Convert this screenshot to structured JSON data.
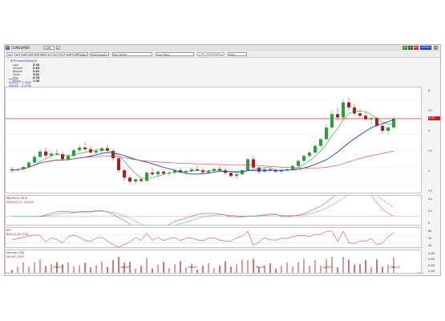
{
  "window": {
    "title": "CONSUMER",
    "symbol": "GSR",
    "footer_left": "1.4",
    "footer_right": "1:0:0"
  },
  "toolbar": {
    "interval": "1D",
    "range_buttons": [
      "1D",
      "1W",
      "1M",
      "3M",
      "6M",
      "1Y",
      "2Y",
      "5Y",
      "10Y",
      "YTD"
    ],
    "period_select": "Date",
    "chart_select": "Trend Supply",
    "study_select": "Bar (Short)",
    "tools_select": "Line (Tool)",
    "right_buttons": [
      "BT",
      "AL",
      "GET",
      "MATRIX"
    ],
    "theme_select": "Dark"
  },
  "quote": {
    "title": "IETFmarketData(D)",
    "rows": [
      {
        "label": "Last",
        "value": "5.40"
      },
      {
        "label": "Volume",
        "value": "5.65"
      },
      {
        "label": "Bid/Ask",
        "value": "5.61"
      },
      {
        "label": "Open",
        "value": "5.61"
      },
      {
        "label": "Chg",
        "value": "0.26"
      },
      {
        "label": "%Chg",
        "value": "1.08"
      }
    ]
  },
  "legend": [
    {
      "name": "MA(5)",
      "value": "",
      "color": "#2e9d3a"
    },
    {
      "name": "MA(20)",
      "value": "5.7406",
      "color": "#1f3fb8"
    },
    {
      "name": "MA(50)",
      "value": "5.3756",
      "color": "#1f3fb8"
    },
    {
      "name": "MA(200)",
      "value": "5.6451",
      "color": "#d04040"
    },
    {
      "name": "5.6.27",
      "value": "",
      "color": "#d04040"
    }
  ],
  "price_tags": [
    {
      "value": "5.44",
      "color": "#555555"
    },
    {
      "value": "5.47",
      "color": "#c62020"
    }
  ],
  "y_axis": [
    "6",
    "5.5",
    "5",
    "4.5",
    "4",
    "3.5"
  ],
  "macd": {
    "title": "MACD(12,26,9)",
    "legend": "MACD(9,12)    -0.0228",
    "y_axis": [
      "0.4",
      "0.2",
      "0"
    ]
  },
  "rsi": {
    "title": "RSI",
    "legend": "RSI(14)    56.1736",
    "y_axis": [
      "60",
      "50",
      "40"
    ]
  },
  "volume": {
    "title": "Volume (1M)",
    "legend": "Vol    847.1240",
    "y_axis": [
      "0.4M",
      "0.3M",
      "0.2M",
      "0.1M"
    ]
  },
  "x_axis": [
    "Dec21",
    "Jan22",
    "Feb22",
    "Mar22",
    "Apr22",
    "May22"
  ],
  "chart_data": {
    "type": "candlestick",
    "x": [
      "Dec21",
      "Jan22",
      "Feb22",
      "Mar22",
      "Apr22",
      "May22"
    ],
    "ohlc": [
      [
        3.95,
        4.02,
        3.85,
        3.92
      ],
      [
        3.92,
        3.98,
        3.88,
        3.95
      ],
      [
        3.95,
        4.05,
        3.9,
        4.02
      ],
      [
        4.02,
        4.2,
        4.0,
        4.15
      ],
      [
        4.15,
        4.38,
        4.1,
        4.32
      ],
      [
        4.32,
        4.55,
        4.28,
        4.48
      ],
      [
        4.48,
        4.6,
        4.3,
        4.36
      ],
      [
        4.36,
        4.5,
        4.25,
        4.42
      ],
      [
        4.42,
        4.55,
        4.35,
        4.4
      ],
      [
        4.4,
        4.48,
        4.2,
        4.25
      ],
      [
        4.25,
        4.4,
        4.18,
        4.35
      ],
      [
        4.35,
        4.58,
        4.3,
        4.52
      ],
      [
        4.52,
        4.7,
        4.45,
        4.6
      ],
      [
        4.6,
        4.75,
        4.5,
        4.55
      ],
      [
        4.55,
        4.65,
        4.4,
        4.45
      ],
      [
        4.45,
        4.58,
        4.38,
        4.5
      ],
      [
        4.5,
        4.62,
        4.42,
        4.58
      ],
      [
        4.58,
        4.68,
        4.45,
        4.5
      ],
      [
        4.5,
        4.55,
        4.2,
        4.28
      ],
      [
        4.28,
        4.3,
        3.85,
        3.92
      ],
      [
        3.92,
        3.98,
        3.6,
        3.7
      ],
      [
        3.7,
        3.78,
        3.52,
        3.58
      ],
      [
        3.58,
        3.7,
        3.5,
        3.65
      ],
      [
        3.65,
        3.72,
        3.55,
        3.6
      ],
      [
        3.6,
        3.9,
        3.58,
        3.85
      ],
      [
        3.85,
        4.0,
        3.75,
        3.8
      ],
      [
        3.8,
        3.92,
        3.7,
        3.88
      ],
      [
        3.88,
        3.95,
        3.78,
        3.82
      ],
      [
        3.82,
        3.9,
        3.75,
        3.85
      ],
      [
        3.85,
        3.95,
        3.8,
        3.92
      ],
      [
        3.92,
        4.0,
        3.82,
        3.86
      ],
      [
        3.86,
        3.94,
        3.78,
        3.9
      ],
      [
        3.9,
        4.0,
        3.85,
        3.95
      ],
      [
        3.95,
        4.05,
        3.88,
        3.92
      ],
      [
        3.92,
        3.98,
        3.82,
        3.86
      ],
      [
        3.86,
        3.95,
        3.8,
        3.9
      ],
      [
        3.9,
        4.0,
        3.85,
        3.96
      ],
      [
        3.96,
        4.05,
        3.9,
        3.92
      ],
      [
        3.92,
        3.98,
        3.8,
        3.84
      ],
      [
        3.84,
        3.9,
        3.7,
        3.75
      ],
      [
        3.75,
        3.85,
        3.65,
        3.8
      ],
      [
        3.8,
        3.95,
        3.78,
        3.92
      ],
      [
        3.92,
        4.3,
        3.9,
        4.25
      ],
      [
        4.25,
        4.35,
        3.95,
        4.0
      ],
      [
        4.0,
        4.05,
        3.8,
        3.88
      ],
      [
        3.88,
        4.0,
        3.85,
        3.95
      ],
      [
        3.95,
        4.0,
        3.88,
        3.92
      ],
      [
        3.92,
        3.98,
        3.85,
        3.88
      ],
      [
        3.88,
        3.95,
        3.82,
        3.92
      ],
      [
        3.92,
        4.0,
        3.88,
        3.95
      ],
      [
        3.95,
        4.1,
        3.92,
        4.05
      ],
      [
        4.05,
        4.25,
        4.0,
        4.2
      ],
      [
        4.2,
        4.4,
        4.15,
        4.35
      ],
      [
        4.35,
        4.5,
        4.3,
        4.45
      ],
      [
        4.45,
        4.7,
        4.4,
        4.65
      ],
      [
        4.65,
        4.9,
        4.6,
        4.85
      ],
      [
        4.85,
        5.3,
        4.8,
        5.2
      ],
      [
        5.2,
        5.7,
        5.15,
        5.6
      ],
      [
        5.6,
        5.8,
        5.4,
        5.5
      ],
      [
        5.5,
        6.05,
        5.45,
        5.95
      ],
      [
        5.95,
        6.1,
        5.7,
        5.8
      ],
      [
        5.8,
        5.9,
        5.55,
        5.62
      ],
      [
        5.62,
        5.75,
        5.5,
        5.55
      ],
      [
        5.55,
        5.65,
        5.4,
        5.45
      ],
      [
        5.45,
        5.55,
        5.3,
        5.48
      ],
      [
        5.48,
        5.52,
        5.2,
        5.25
      ],
      [
        5.25,
        5.3,
        5.02,
        5.1
      ],
      [
        5.1,
        5.25,
        5.0,
        5.2
      ],
      [
        5.2,
        5.5,
        5.15,
        5.47
      ]
    ],
    "ylim": [
      3.3,
      6.3
    ],
    "series": [
      {
        "name": "MA(5)"
      },
      {
        "name": "MA(20)"
      },
      {
        "name": "MA(200)"
      }
    ]
  }
}
